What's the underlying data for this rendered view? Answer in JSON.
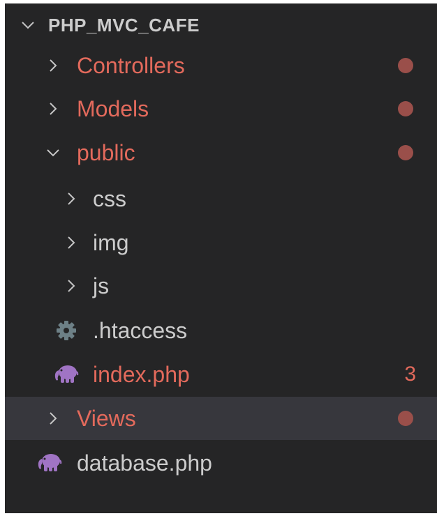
{
  "explorer": {
    "root": {
      "label": "PHP_MVC_CAFE",
      "expanded": true
    },
    "items": [
      {
        "label": "Controllers",
        "type": "folder",
        "expanded": false,
        "modified": true
      },
      {
        "label": "Models",
        "type": "folder",
        "expanded": false,
        "modified": true
      },
      {
        "label": "public",
        "type": "folder",
        "expanded": true,
        "modified": true
      },
      {
        "label": "css",
        "type": "folder",
        "expanded": false,
        "modified": false
      },
      {
        "label": "img",
        "type": "folder",
        "expanded": false,
        "modified": false
      },
      {
        "label": "js",
        "type": "folder",
        "expanded": false,
        "modified": false
      },
      {
        "label": ".htaccess",
        "type": "file",
        "icon": "gear-icon",
        "modified": false
      },
      {
        "label": "index.php",
        "type": "file",
        "icon": "php-elephant-icon",
        "modified": true,
        "problem_count": "3"
      },
      {
        "label": "Views",
        "type": "folder",
        "expanded": false,
        "modified": true,
        "selected": true
      },
      {
        "label": "database.php",
        "type": "file",
        "icon": "php-elephant-icon",
        "modified": false
      }
    ]
  },
  "colors": {
    "background": "#252526",
    "selected_row": "#37373d",
    "modified_text": "#e36a5c",
    "modified_dot": "#9a4f4a",
    "default_text": "#cccccc",
    "php_icon": "#a074c4",
    "gear_icon": "#6d8086"
  }
}
